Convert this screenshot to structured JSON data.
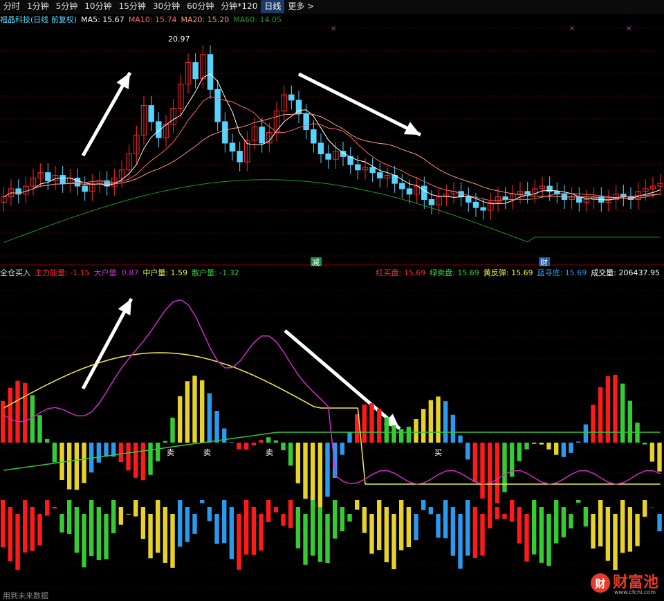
{
  "tabs": [
    "分时",
    "1分钟",
    "5分钟",
    "10分钟",
    "15分钟",
    "30分钟",
    "60分钟",
    "分钟*120",
    "日线",
    "更多 >"
  ],
  "active_tab": 8,
  "colors": {
    "up": "#ff2a2a",
    "down": "#55d4ff",
    "ma5": "#ffffff",
    "ma10": "#ff6a6a",
    "ma20": "#ff9a7a",
    "ma60": "#1e9a1e",
    "red": "#ff1a1a",
    "green": "#33cc33",
    "yellow": "#e6d22a",
    "blue": "#2a9aee",
    "magenta": "#d02ad0",
    "ylw_line": "#f0f040",
    "grn_line": "#33cc33"
  },
  "price_legend": {
    "name": "福晶科技(日线 前复权)",
    "ma5": "MA5: 15.67",
    "ma10": "MA10: 15.74",
    "ma20": "MA20: 15.20",
    "ma60": "MA60: 14.05"
  },
  "ind_legend": {
    "title": "全仓买入",
    "zhuli": "主力能量: -1.15",
    "dahu": "大户量: 0.87",
    "zhonghu": "中户量: 1.59",
    "sanhu": "散户量: -1.32",
    "hongmai": "红买盘: 15.69",
    "lvmai": "绿卖盘: 15.69",
    "huangfan": "黄反弹: 15.69",
    "lanxun": "蓝寻底: 15.69",
    "chengjiao": "成交量: 206437.95"
  },
  "annotations": {
    "high_label": "20.97",
    "jian": "减",
    "cai": "财",
    "mai_sell": "卖",
    "mai_buy": "买"
  },
  "logo": {
    "mark": "财",
    "text": "财富池",
    "url": "www.cfchi.com"
  },
  "footer": "用到未来数据",
  "chart_data": {
    "type": "candlestick+indicator",
    "candles_close": [
      15.2,
      15.5,
      15.3,
      15.6,
      15.9,
      16.1,
      15.8,
      16.0,
      15.7,
      15.9,
      15.6,
      15.4,
      15.7,
      15.8,
      15.6,
      15.9,
      16.2,
      16.8,
      17.5,
      18.6,
      18.0,
      17.4,
      17.9,
      18.5,
      19.4,
      20.2,
      19.6,
      20.5,
      19.2,
      18.0,
      17.2,
      16.9,
      16.5,
      17.3,
      17.8,
      17.2,
      17.6,
      18.4,
      19.0,
      18.8,
      18.3,
      17.7,
      17.2,
      16.8,
      16.6,
      16.9,
      16.7,
      16.4,
      16.2,
      16.3,
      16.1,
      15.9,
      16.0,
      15.7,
      15.5,
      15.3,
      15.6,
      15.1,
      14.9,
      15.2,
      15.3,
      15.4,
      15.2,
      15.0,
      14.8,
      14.7,
      15.0,
      15.2,
      15.1,
      15.3,
      15.4,
      15.3,
      15.5,
      15.6,
      15.4,
      15.3,
      15.1,
      15.2,
      15.0,
      15.1,
      15.2,
      15.0,
      15.1,
      15.3,
      15.2,
      15.1,
      15.4,
      15.5,
      15.6,
      15.7
    ],
    "ylim": [
      13.0,
      21.5
    ]
  }
}
